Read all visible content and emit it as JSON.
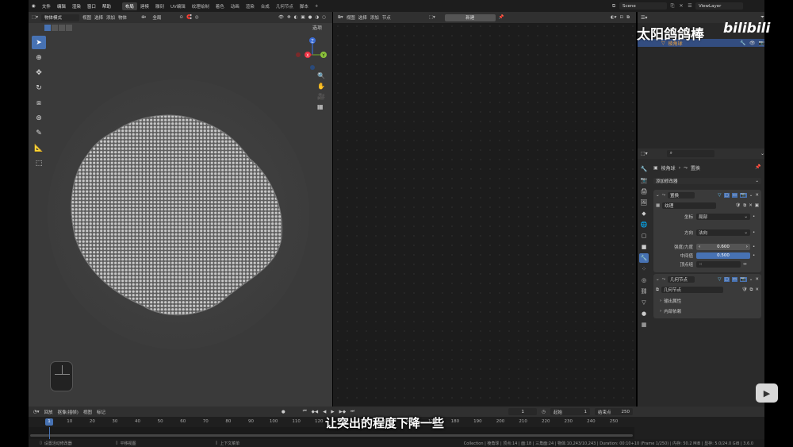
{
  "menu": [
    "文件",
    "编辑",
    "渲染",
    "窗口",
    "帮助"
  ],
  "workspaces": [
    "布局",
    "建模",
    "雕刻",
    "UV编辑",
    "纹理绘制",
    "着色",
    "动画",
    "渲染",
    "合成",
    "几何节点",
    "脚本"
  ],
  "active_workspace": "布局",
  "scene": "Scene",
  "view_layer": "ViewLayer",
  "viewport": {
    "mode": "物体模式",
    "menus": [
      "视图",
      "选择",
      "添加",
      "物体"
    ],
    "transform": "全局",
    "options": "选项",
    "gizmo": {
      "x": "X",
      "y": "Y",
      "z": "Z"
    }
  },
  "node_editor": {
    "menus": [
      "视图",
      "选择",
      "添加",
      "节点"
    ],
    "new_button": "新建"
  },
  "outliner": {
    "object": "棱角球"
  },
  "properties": {
    "breadcrumb_object": "棱角球",
    "breadcrumb_modifier": "置换",
    "add_modifier": "添加修改器",
    "displace": {
      "name": "置换",
      "texture_label": "纹理",
      "coords_label": "坐标",
      "coords_value": "局部",
      "direction_label": "方向",
      "direction_value": "法向",
      "strength_label": "强度/力度",
      "strength_value": "0.600",
      "midlevel_label": "中间值",
      "midlevel_value": "0.500",
      "vgroup_label": "顶点组"
    },
    "geonodes": {
      "name": "几何节点",
      "group": "几何节点",
      "output_attrs": "输出属性",
      "internal_deps": "内部依赖"
    }
  },
  "timeline": {
    "menus": [
      "回放",
      "抠像(插帧)",
      "视图",
      "标记"
    ],
    "current_frame": "1",
    "start_label": "起始",
    "start": "1",
    "end_label": "结束点",
    "end": "250",
    "ticks": [
      "1",
      "10",
      "20",
      "30",
      "40",
      "50",
      "60",
      "70",
      "80",
      "90",
      "100",
      "110",
      "120",
      "130",
      "140",
      "150",
      "160",
      "170",
      "180",
      "190",
      "200",
      "210",
      "220",
      "230",
      "240",
      "250"
    ]
  },
  "status": {
    "left": "设置活动修改器",
    "mid": "平移视图",
    "right_hint": "上下文菜单",
    "info": "Collection | 棱角球 | 顶点:14 | 面:18 | 三角面:24 | 物体:10,243/10,243 | Duration: 00:10+10 (Frame 1/250) | 内存: 50.2 MiB | 显存: 5.0/24.0 GiB | 3.6.0"
  },
  "overlay": {
    "subtitle": "让突出的程度下降一些",
    "watermark": "太阳鸽鸽棒",
    "bili": "bilibili"
  }
}
